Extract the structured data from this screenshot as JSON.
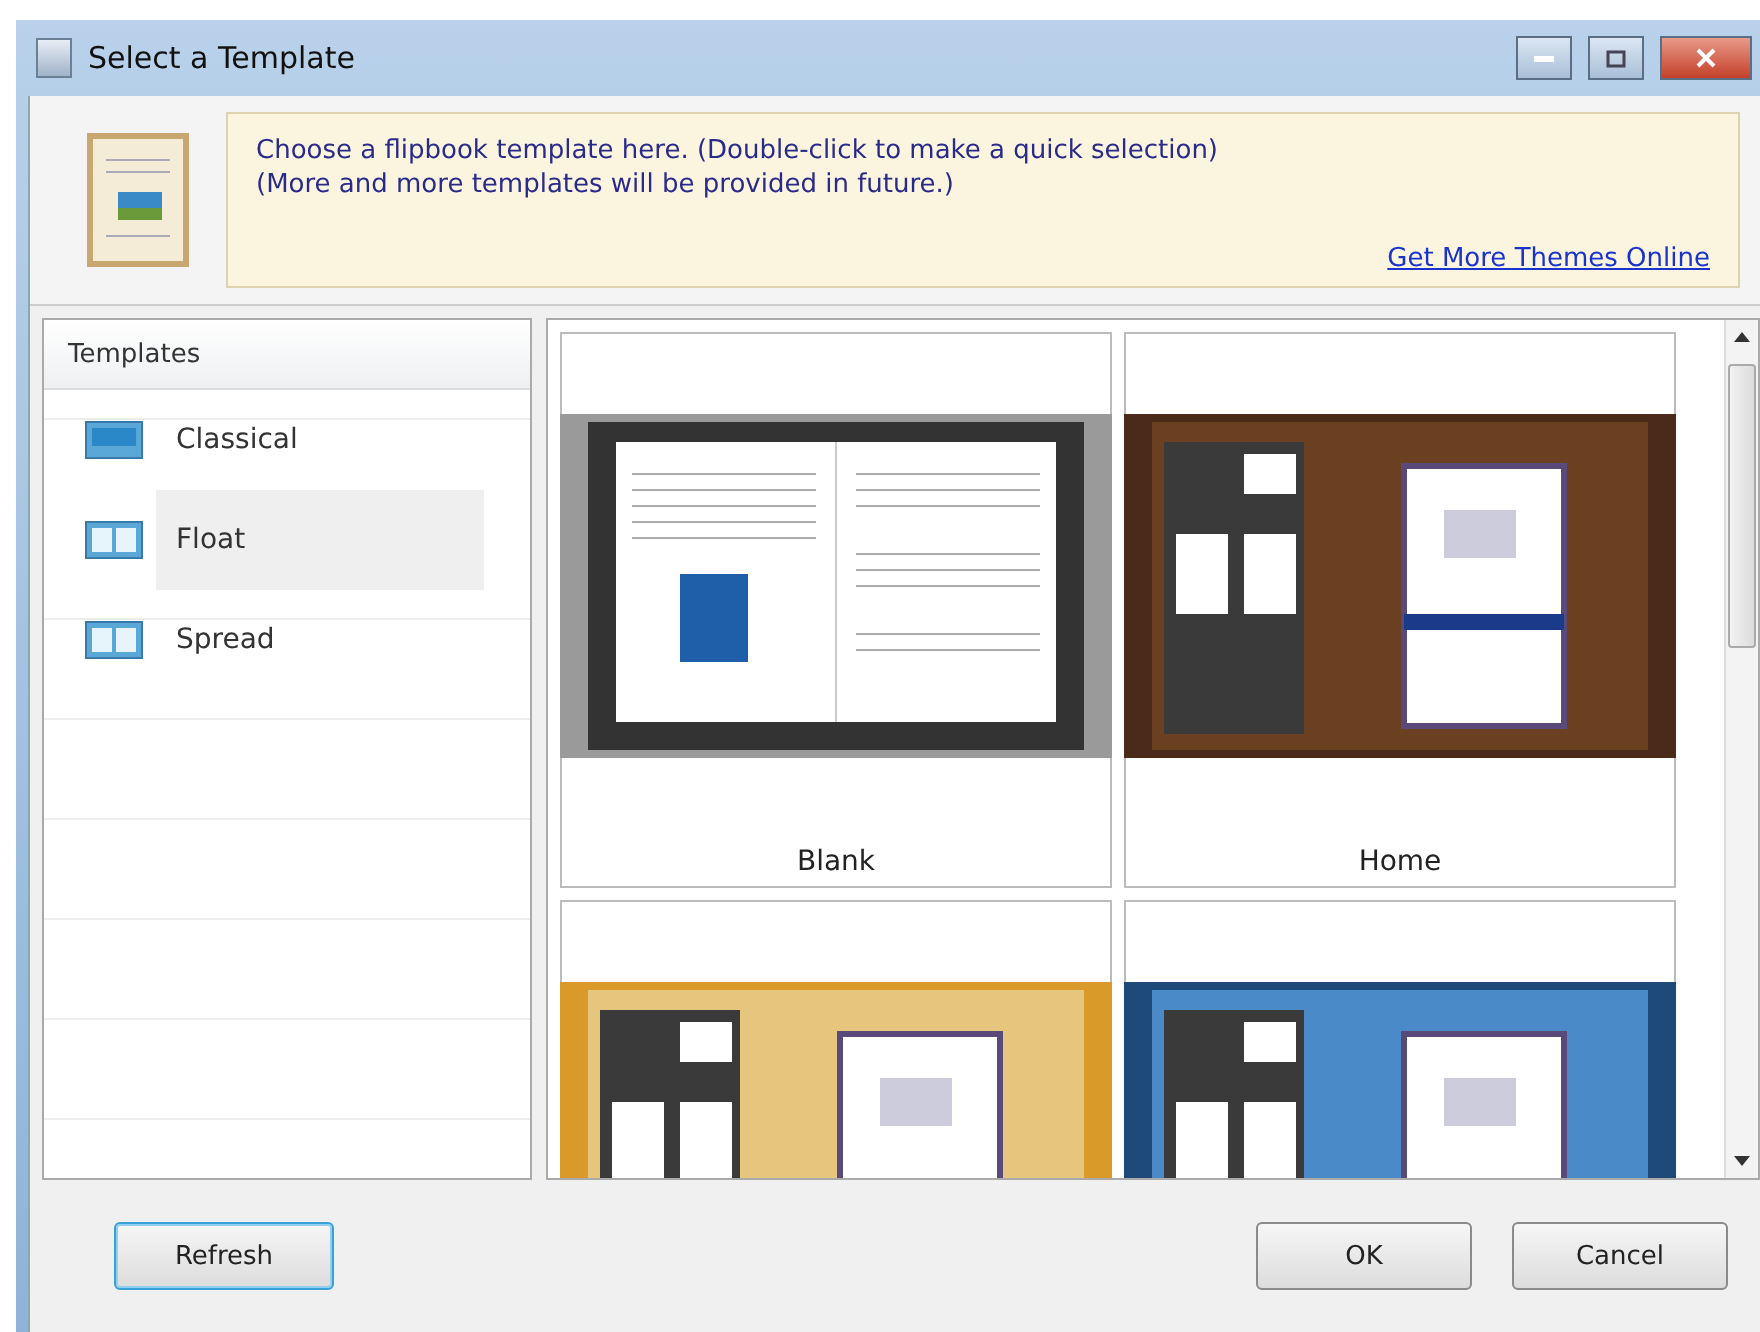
{
  "window": {
    "title": "Select a Template"
  },
  "banner": {
    "lines": [
      "Choose a flipbook template here. (Double-click to make a quick selection)",
      "(More and more templates will be provided in future.)"
    ],
    "link": "Get More Themes Online"
  },
  "sidebar": {
    "header": "Templates",
    "items": [
      {
        "label": "Classical",
        "selected": false
      },
      {
        "label": "Float",
        "selected": true
      },
      {
        "label": "Spread",
        "selected": false
      }
    ]
  },
  "templates": [
    {
      "name": "Blank",
      "kind": "book"
    },
    {
      "name": "Home",
      "kind": "room"
    },
    {
      "kind": "wood"
    },
    {
      "kind": "blue"
    }
  ],
  "buttons": {
    "left": [
      "Refresh"
    ],
    "right": [
      "OK",
      "Cancel"
    ]
  }
}
